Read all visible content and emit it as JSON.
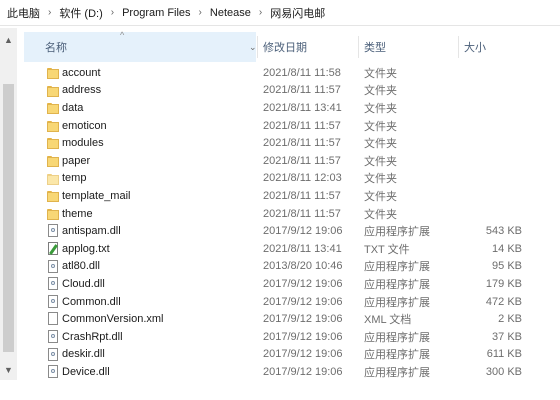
{
  "breadcrumb": [
    "此电脑",
    "软件 (D:)",
    "Program Files",
    "Netease",
    "网易闪电邮"
  ],
  "columns": {
    "name": "名称",
    "date": "修改日期",
    "type": "类型",
    "size": "大小"
  },
  "files": [
    {
      "name": "account",
      "date": "2021/8/11 11:58",
      "type": "文件夹",
      "size": "",
      "icon": "folder-icon"
    },
    {
      "name": "address",
      "date": "2021/8/11 11:57",
      "type": "文件夹",
      "size": "",
      "icon": "folder-icon"
    },
    {
      "name": "data",
      "date": "2021/8/11 13:41",
      "type": "文件夹",
      "size": "",
      "icon": "folder-icon"
    },
    {
      "name": "emoticon",
      "date": "2021/8/11 11:57",
      "type": "文件夹",
      "size": "",
      "icon": "folder-icon"
    },
    {
      "name": "modules",
      "date": "2021/8/11 11:57",
      "type": "文件夹",
      "size": "",
      "icon": "folder-icon"
    },
    {
      "name": "paper",
      "date": "2021/8/11 11:57",
      "type": "文件夹",
      "size": "",
      "icon": "folder-icon"
    },
    {
      "name": "temp",
      "date": "2021/8/11 12:03",
      "type": "文件夹",
      "size": "",
      "icon": "folder-light-icon"
    },
    {
      "name": "template_mail",
      "date": "2021/8/11 11:57",
      "type": "文件夹",
      "size": "",
      "icon": "folder-icon"
    },
    {
      "name": "theme",
      "date": "2021/8/11 11:57",
      "type": "文件夹",
      "size": "",
      "icon": "folder-icon"
    },
    {
      "name": "antispam.dll",
      "date": "2017/9/12 19:06",
      "type": "应用程序扩展",
      "size": "543 KB",
      "icon": "dll-icon"
    },
    {
      "name": "applog.txt",
      "date": "2021/8/11 13:41",
      "type": "TXT 文件",
      "size": "14 KB",
      "icon": "txt-icon"
    },
    {
      "name": "atl80.dll",
      "date": "2013/8/20 10:46",
      "type": "应用程序扩展",
      "size": "95 KB",
      "icon": "dll-icon"
    },
    {
      "name": "Cloud.dll",
      "date": "2017/9/12 19:06",
      "type": "应用程序扩展",
      "size": "179 KB",
      "icon": "dll-icon"
    },
    {
      "name": "Common.dll",
      "date": "2017/9/12 19:06",
      "type": "应用程序扩展",
      "size": "472 KB",
      "icon": "dll-icon"
    },
    {
      "name": "CommonVersion.xml",
      "date": "2017/9/12 19:06",
      "type": "XML 文档",
      "size": "2 KB",
      "icon": "xml-icon"
    },
    {
      "name": "CrashRpt.dll",
      "date": "2017/9/12 19:06",
      "type": "应用程序扩展",
      "size": "37 KB",
      "icon": "dll-icon"
    },
    {
      "name": "deskir.dll",
      "date": "2017/9/12 19:06",
      "type": "应用程序扩展",
      "size": "611 KB",
      "icon": "dll-icon"
    },
    {
      "name": "Device.dll",
      "date": "2017/9/12 19:06",
      "type": "应用程序扩展",
      "size": "300 KB",
      "icon": "dll-icon"
    }
  ]
}
